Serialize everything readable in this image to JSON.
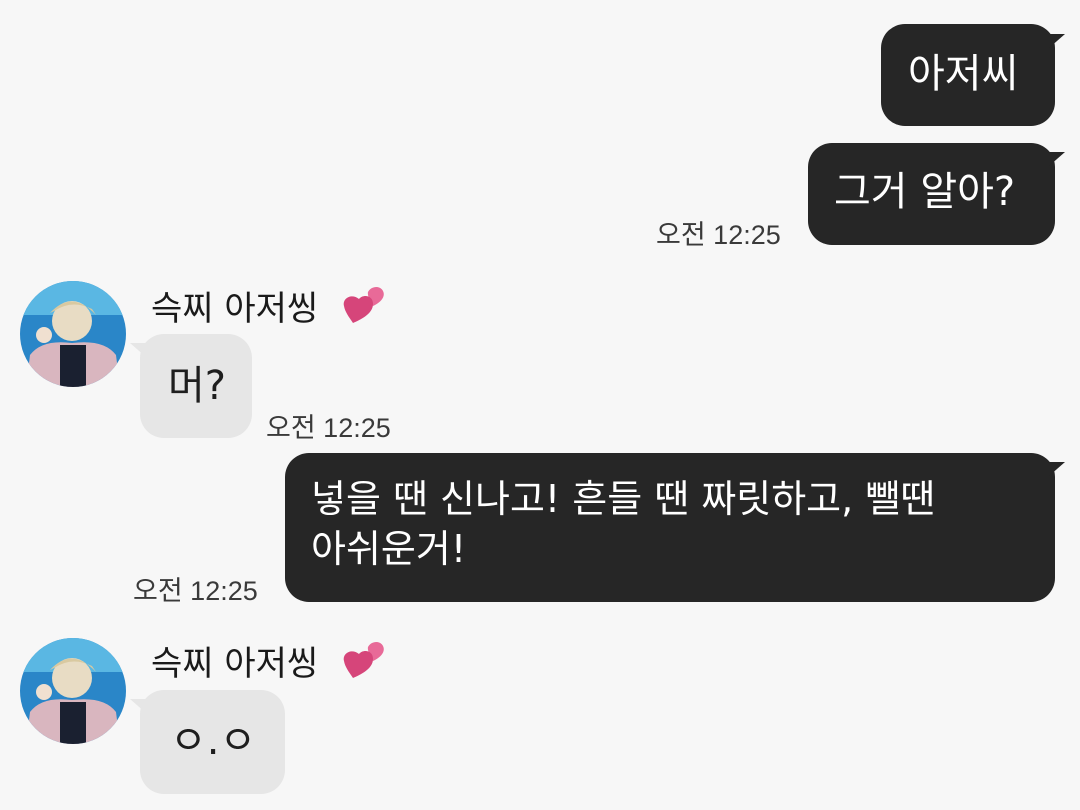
{
  "messages": [
    {
      "direction": "outgoing",
      "text": "아저씨"
    },
    {
      "direction": "outgoing",
      "text": "그거 알아?",
      "time": "오전 12:25"
    },
    {
      "direction": "incoming",
      "sender": "슥찌 아저씽",
      "text": "머?",
      "time": "오전 12:25"
    },
    {
      "direction": "outgoing",
      "lines": [
        "넣을 땐 신나고! 흔들 땐 짜릿하고, 뺄땐",
        "아쉬운거!"
      ],
      "time": "오전 12:25"
    },
    {
      "direction": "incoming",
      "sender": "슥찌 아저씽",
      "text": "ㅇ.ㅇ"
    }
  ],
  "colors": {
    "background": "#f7f7f7",
    "outgoing_bubble": "#262626",
    "incoming_bubble": "#e6e6e6",
    "heart": "#e0507a"
  },
  "icons": [
    "pink-heart-icon",
    "contact-avatar"
  ]
}
